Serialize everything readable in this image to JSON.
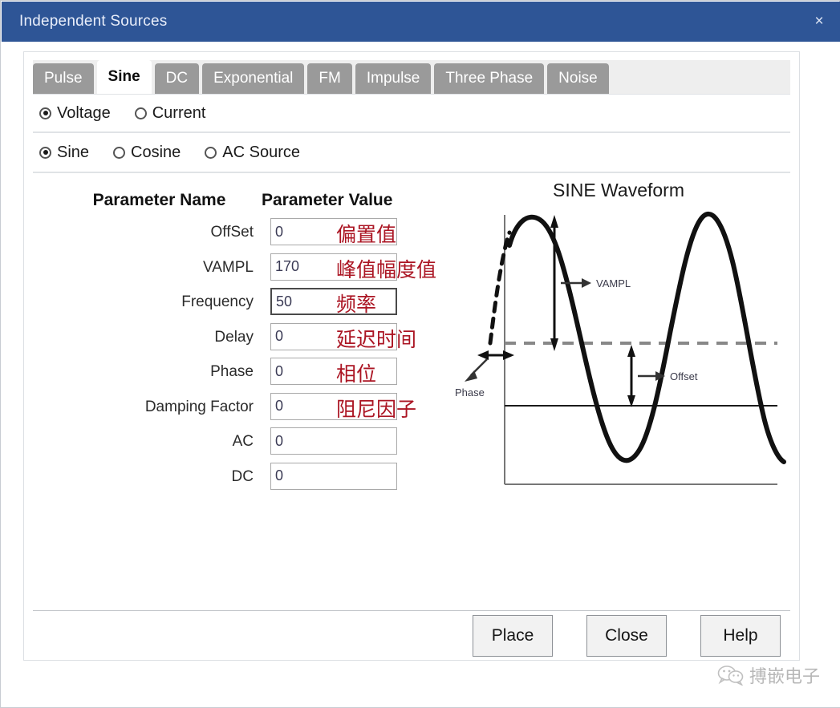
{
  "window": {
    "title": "Independent Sources",
    "close_label": "×",
    "titlebar_color": "#2e5596"
  },
  "tabs": [
    {
      "label": "Pulse",
      "active": false
    },
    {
      "label": "Sine",
      "active": true
    },
    {
      "label": "DC",
      "active": false
    },
    {
      "label": "Exponential",
      "active": false
    },
    {
      "label": "FM",
      "active": false
    },
    {
      "label": "Impulse",
      "active": false
    },
    {
      "label": "Three Phase",
      "active": false
    },
    {
      "label": "Noise",
      "active": false
    }
  ],
  "source_type": {
    "options": [
      {
        "label": "Voltage",
        "selected": true
      },
      {
        "label": "Current",
        "selected": false
      }
    ]
  },
  "wave_type": {
    "options": [
      {
        "label": "Sine",
        "selected": true
      },
      {
        "label": "Cosine",
        "selected": false
      },
      {
        "label": "AC Source",
        "selected": false
      }
    ]
  },
  "parameters": {
    "header_name": "Parameter Name",
    "header_value": "Parameter Value",
    "rows": [
      {
        "name": "OffSet",
        "value": "0",
        "note": "偏置值",
        "focused": false
      },
      {
        "name": "VAMPL",
        "value": "170",
        "note": "峰值幅度值",
        "focused": false
      },
      {
        "name": "Frequency",
        "value": "50",
        "note": "频率",
        "focused": true
      },
      {
        "name": "Delay",
        "value": "0",
        "note": "延迟时间",
        "focused": false
      },
      {
        "name": "Phase",
        "value": "0",
        "note": "相位",
        "focused": false
      },
      {
        "name": "Damping Factor",
        "value": "0",
        "note": "阻尼因子",
        "focused": false
      },
      {
        "name": "AC",
        "value": "0",
        "note": "",
        "focused": false
      },
      {
        "name": "DC",
        "value": "0",
        "note": "",
        "focused": false
      }
    ]
  },
  "waveform": {
    "title": "SINE Waveform",
    "labels": {
      "vampl": "VAMPL",
      "offset": "Offset",
      "phase": "Phase"
    }
  },
  "footer": {
    "buttons": [
      {
        "label": "Place"
      },
      {
        "label": "Close"
      },
      {
        "label": "Help"
      }
    ]
  },
  "watermark": {
    "text": "搏嵌电子",
    "icon": "wechat-icon"
  },
  "colors": {
    "accent": "#2e5596",
    "annotation_red": "#ab1523",
    "tab_inactive": "#9a9a9a"
  }
}
